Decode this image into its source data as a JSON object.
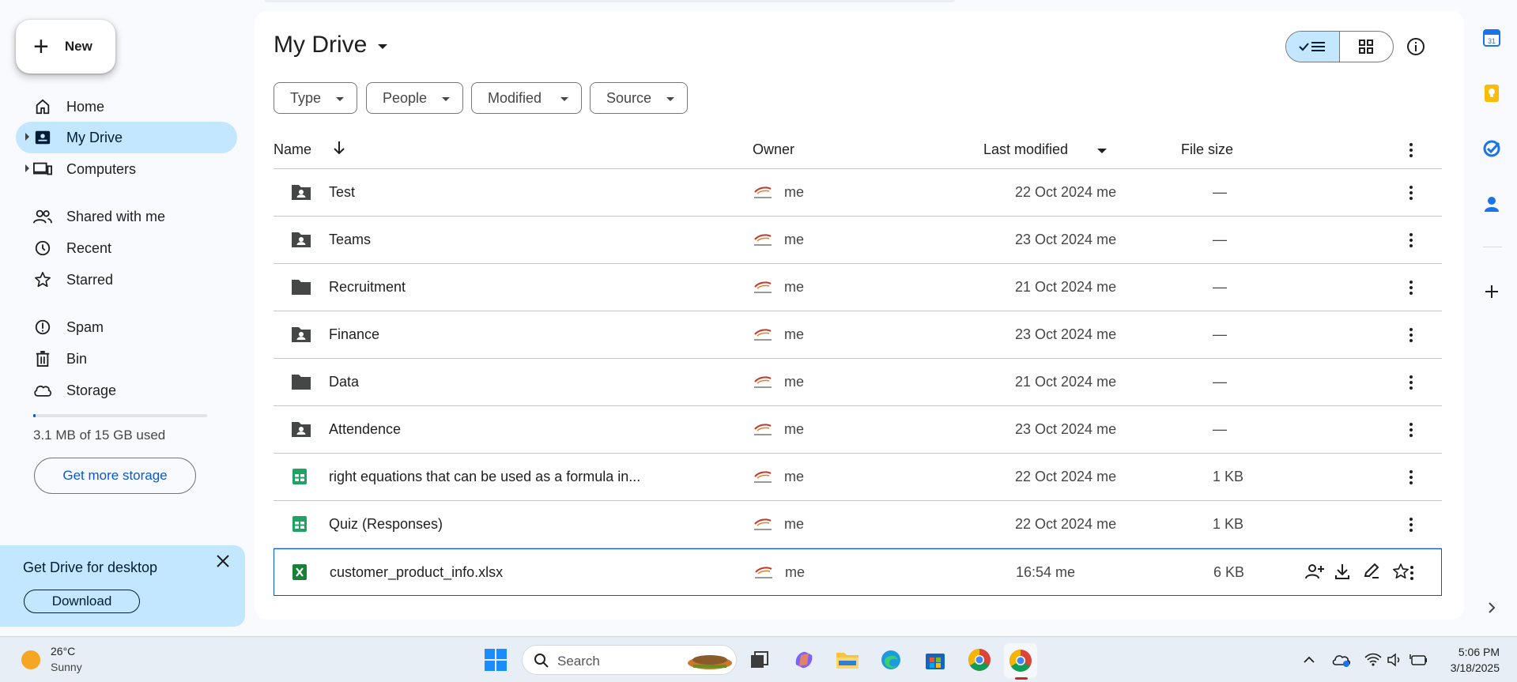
{
  "sidebar": {
    "new_label": "New",
    "items": [
      {
        "label": "Home",
        "icon": "home-icon"
      },
      {
        "label": "My Drive",
        "icon": "my-drive-icon"
      },
      {
        "label": "Computers",
        "icon": "computers-icon"
      },
      {
        "label": "Shared with me",
        "icon": "shared-icon"
      },
      {
        "label": "Recent",
        "icon": "clock-icon"
      },
      {
        "label": "Starred",
        "icon": "star-icon"
      },
      {
        "label": "Spam",
        "icon": "spam-icon"
      },
      {
        "label": "Bin",
        "icon": "bin-icon"
      },
      {
        "label": "Storage",
        "icon": "cloud-icon"
      }
    ],
    "storage_text": "3.1 MB of 15 GB used",
    "storage_fraction": 0.0002,
    "get_more_storage": "Get more storage",
    "promo": {
      "title": "Get Drive for desktop",
      "download": "Download"
    }
  },
  "main": {
    "title": "My Drive",
    "filters": [
      "Type",
      "People",
      "Modified",
      "Source"
    ],
    "columns": {
      "name": "Name",
      "owner": "Owner",
      "modified": "Last modified",
      "size": "File size"
    },
    "rows": [
      {
        "name": "Test",
        "type": "shared-folder",
        "owner": "me",
        "modified": "22 Oct 2024 me",
        "size": "—"
      },
      {
        "name": "Teams",
        "type": "shared-folder",
        "owner": "me",
        "modified": "23 Oct 2024 me",
        "size": "—"
      },
      {
        "name": "Recruitment",
        "type": "folder",
        "owner": "me",
        "modified": "21 Oct 2024 me",
        "size": "—"
      },
      {
        "name": "Finance",
        "type": "shared-folder",
        "owner": "me",
        "modified": "23 Oct 2024 me",
        "size": "—"
      },
      {
        "name": "Data",
        "type": "folder",
        "owner": "me",
        "modified": "21 Oct 2024 me",
        "size": "—"
      },
      {
        "name": "Attendence",
        "type": "shared-folder",
        "owner": "me",
        "modified": "23 Oct 2024 me",
        "size": "—"
      },
      {
        "name": "right equations that can be used as a formula in...",
        "type": "sheet",
        "owner": "me",
        "modified": "22 Oct 2024 me",
        "size": "1 KB"
      },
      {
        "name": "Quiz (Responses)",
        "type": "sheet",
        "owner": "me",
        "modified": "22 Oct 2024 me",
        "size": "1 KB"
      },
      {
        "name": "customer_product_info.xlsx",
        "type": "excel",
        "owner": "me",
        "modified": "16:54 me",
        "size": "6 KB",
        "selected": true
      }
    ]
  },
  "taskbar": {
    "temperature": "26°C",
    "condition": "Sunny",
    "search_label": "Search",
    "time": "5:06 PM",
    "date": "3/18/2025"
  },
  "colors": {
    "accent": "#0b57d0",
    "active_nav": "#c2e7ff",
    "sheets_green": "#1ea362",
    "excel_green": "#188038",
    "folder_gray": "#444746"
  }
}
